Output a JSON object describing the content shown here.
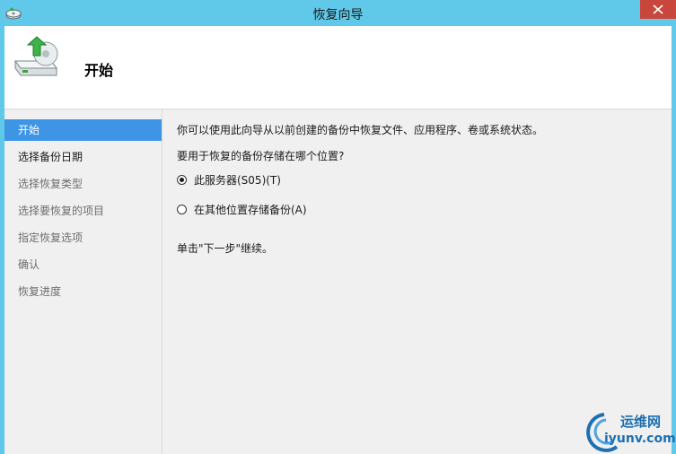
{
  "window": {
    "title": "恢复向导"
  },
  "header": {
    "title": "开始"
  },
  "nav": {
    "items": [
      {
        "label": "开始",
        "state": "active"
      },
      {
        "label": "选择备份日期",
        "state": "enabled"
      },
      {
        "label": "选择恢复类型",
        "state": "disabled"
      },
      {
        "label": "选择要恢复的项目",
        "state": "disabled"
      },
      {
        "label": "指定恢复选项",
        "state": "disabled"
      },
      {
        "label": "确认",
        "state": "disabled"
      },
      {
        "label": "恢复进度",
        "state": "disabled"
      }
    ]
  },
  "main": {
    "intro": "你可以使用此向导从以前创建的备份中恢复文件、应用程序、卷或系统状态。",
    "question": "要用于恢复的备份存储在哪个位置?",
    "options": [
      {
        "label": "此服务器(S05)(T)",
        "selected": true
      },
      {
        "label": "在其他位置存储备份(A)",
        "selected": false
      }
    ],
    "hint": "单击\"下一步\"继续。"
  },
  "watermark": {
    "line1": "运维网",
    "line2": "iyunv.com"
  },
  "colors": {
    "titlebar": "#60c8e8",
    "nav_active": "#3e95e5",
    "close": "#c9463d"
  }
}
